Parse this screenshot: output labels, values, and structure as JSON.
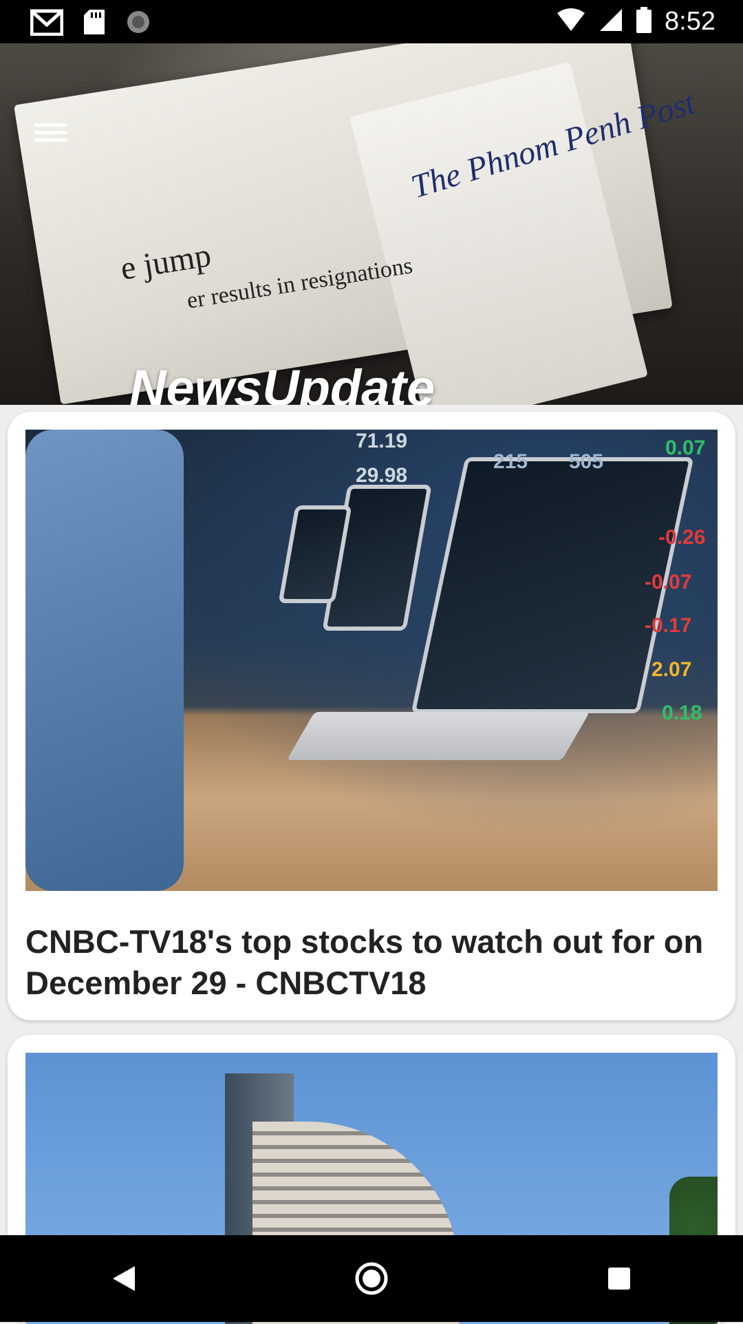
{
  "status_bar": {
    "time": "8:52",
    "left_icons": [
      "gmail-icon",
      "sd-card-icon",
      "sync-icon"
    ],
    "right_icons": [
      "wifi-icon",
      "signal-icon",
      "battery-icon"
    ]
  },
  "header": {
    "app_title": "NewsUpdate",
    "menu_icon": "hamburger-menu-icon",
    "image_text": {
      "masthead": "The Phnom Penh Post",
      "headline": "er results in resignations",
      "big_word": "e jump"
    }
  },
  "articles": [
    {
      "title": "CNBC-TV18's top stocks to watch out for on December 29 - CNBCTV18",
      "image": "stock-traders-laptops-image",
      "image_numbers": [
        "71.19",
        "29.98",
        "215",
        "505",
        "0.07",
        "-0.26",
        "-0.07",
        "-0.17",
        "2.07",
        "0.18"
      ]
    },
    {
      "title": "",
      "image": "stock-exchange-building-image"
    }
  ],
  "nav_bar": {
    "back": "back-icon",
    "home": "home-icon",
    "recents": "recents-icon"
  }
}
